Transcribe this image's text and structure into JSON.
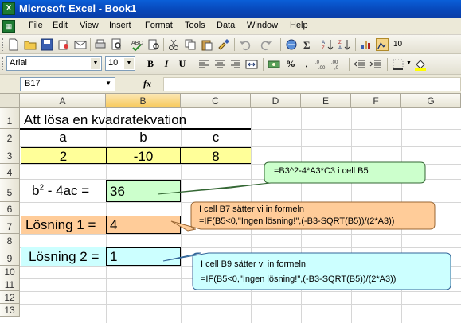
{
  "window": {
    "title": "Microsoft Excel - Book1",
    "app_icon": "X"
  },
  "menu": [
    "File",
    "Edit",
    "View",
    "Insert",
    "Format",
    "Tools",
    "Data",
    "Window",
    "Help"
  ],
  "menu_underline": [
    "F",
    "E",
    "V",
    "I",
    "o",
    "T",
    "D",
    "W",
    "H"
  ],
  "format_toolbar": {
    "font": "Arial",
    "size": "10",
    "bold": "B",
    "italic": "I",
    "underline": "U",
    "percent": "%",
    "comma": ","
  },
  "formula_bar": {
    "name_box": "B17",
    "fx": "fx",
    "formula": ""
  },
  "columns": [
    "A",
    "B",
    "C",
    "D",
    "E",
    "F",
    "G"
  ],
  "rows": [
    "1",
    "2",
    "3",
    "4",
    "5",
    "6",
    "7",
    "8",
    "9",
    "10",
    "11",
    "12",
    "13"
  ],
  "sheet": {
    "title": "Att lösa en kvadratekvation",
    "headers": [
      "a",
      "b",
      "c"
    ],
    "values": [
      "2",
      "-10",
      "8"
    ],
    "discriminant_label_pre": "b",
    "discriminant_label_sup": "2",
    "discriminant_label_post": " - 4ac =",
    "discriminant_value": "36",
    "solution1_label": "Lösning 1 =",
    "solution1_value": "4",
    "solution2_label": "Lösning 2 =",
    "solution2_value": "1"
  },
  "callouts": {
    "discriminant": "=B3^2-4*A3*C3  i cell B5",
    "solution1_line1": "I cell B7 sätter vi in formeln",
    "solution1_line2": "=IF(B5<0,\"Ingen lösning!\",(-B3-SQRT(B5))/(2*A3))",
    "solution2_line1": "I cell B9 sätter vi in formeln",
    "solution2_line2": "=IF(B5<0,\"Ingen lösning!\",(-B3-SQRT(B5))/(2*A3))"
  },
  "colors": {
    "titlebar": "#0846b8",
    "yellow_fill": "#ffff99",
    "green_fill": "#ccffcc",
    "orange_fill": "#ffcc99",
    "cyan_fill": "#ccffff",
    "callout_green": "#ccffcc",
    "callout_orange": "#ffcc99",
    "callout_cyan": "#ccffff"
  }
}
